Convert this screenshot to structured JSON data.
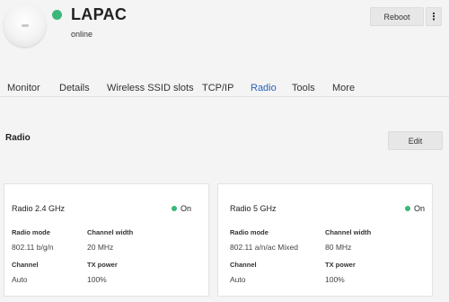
{
  "device": {
    "name": "LAPAC",
    "status": "online",
    "status_color": "#3cb67a",
    "image": "access-point-device"
  },
  "header": {
    "reboot_label": "Reboot",
    "more_label": "⋮"
  },
  "tabs": [
    {
      "label": "Monitor"
    },
    {
      "label": "Details"
    },
    {
      "label": "Wireless SSID slots"
    },
    {
      "label": "TCP/IP"
    },
    {
      "label": "Radio"
    },
    {
      "label": "Tools"
    },
    {
      "label": "More"
    }
  ],
  "active_tab": "Radio",
  "accent_color": "#2a62b8",
  "section": {
    "title": "Radio",
    "edit_label": "Edit"
  },
  "radios": [
    {
      "title": "Radio 2.4 GHz",
      "state": "On",
      "state_color": "#3cb67a",
      "radio_mode_label": "Radio mode",
      "radio_mode": "802.11 b/g/n",
      "channel_width_label": "Channel width",
      "channel_width": "20 MHz",
      "channel_label": "Channel",
      "channel": "Auto",
      "tx_power_label": "TX power",
      "tx_power": "100%"
    },
    {
      "title": "Radio 5 GHz",
      "state": "On",
      "state_color": "#3cb67a",
      "radio_mode_label": "Radio mode",
      "radio_mode": "802.11 a/n/ac Mixed",
      "channel_width_label": "Channel width",
      "channel_width": "80 MHz",
      "channel_label": "Channel",
      "channel": "Auto",
      "tx_power_label": "TX power",
      "tx_power": "100%"
    }
  ]
}
